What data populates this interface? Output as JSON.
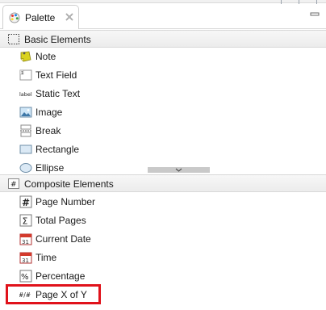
{
  "tab": {
    "label": "Palette"
  },
  "drawers": [
    {
      "label": "Basic Elements",
      "items": [
        {
          "label": "Note",
          "icon": "note-icon"
        },
        {
          "label": "Text Field",
          "icon": "text-field-icon"
        },
        {
          "label": "Static Text",
          "icon": "static-text-icon",
          "icon_text": "label"
        },
        {
          "label": "Image",
          "icon": "image-icon"
        },
        {
          "label": "Break",
          "icon": "break-icon"
        },
        {
          "label": "Rectangle",
          "icon": "rectangle-icon"
        },
        {
          "label": "Ellipse",
          "icon": "ellipse-icon"
        }
      ]
    },
    {
      "label": "Composite Elements",
      "items": [
        {
          "label": "Page Number",
          "icon": "page-number-icon",
          "icon_text": "#"
        },
        {
          "label": "Total Pages",
          "icon": "total-pages-icon",
          "icon_text": "Σ"
        },
        {
          "label": "Current Date",
          "icon": "current-date-icon",
          "icon_text": "31"
        },
        {
          "label": "Time",
          "icon": "time-icon",
          "icon_text": "31"
        },
        {
          "label": "Percentage",
          "icon": "percentage-icon",
          "icon_text": "%"
        },
        {
          "label": "Page X of Y",
          "icon": "page-x-of-y-icon",
          "icon_text": "#/#"
        }
      ]
    }
  ],
  "colors": {
    "highlight": "#e0121b",
    "header_bg": "#efefef"
  }
}
